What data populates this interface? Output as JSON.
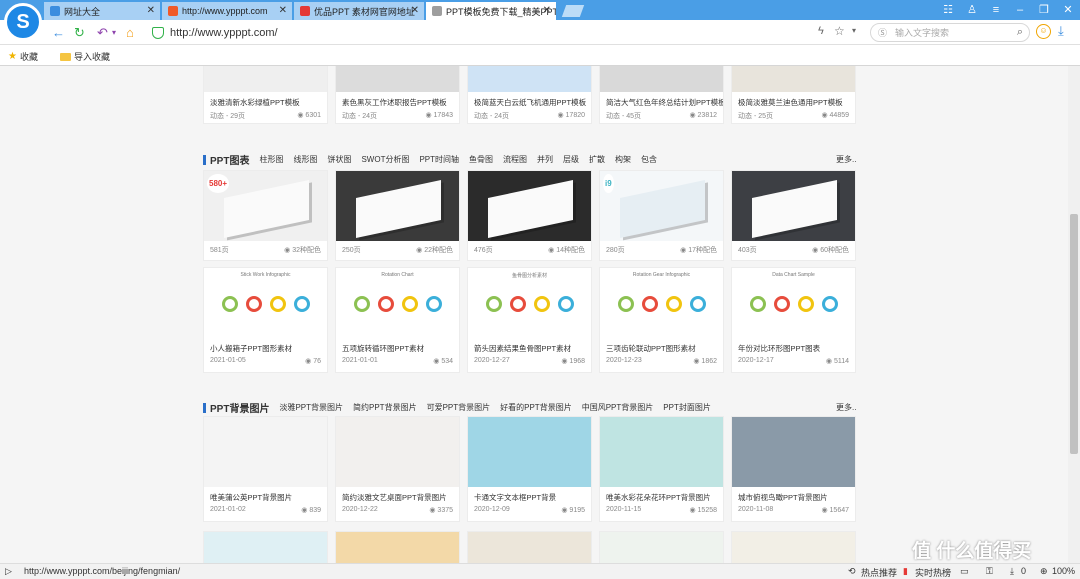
{
  "browser": {
    "tabs": [
      {
        "label": "网址大全",
        "fav_color": "#3b8ddf",
        "active": false
      },
      {
        "label": "http://www.ypppt.com",
        "fav_color": "#f05a28",
        "active": false
      },
      {
        "label": "优品PPT 素材网官网地址",
        "fav_color": "#e53935",
        "active": false
      },
      {
        "label": "PPT模板免费下载_精美PPT",
        "fav_color": "#9e9e9e",
        "active": true
      }
    ],
    "url": "http://www.ypppt.com/",
    "search_placeholder": "输入文字搜索",
    "bookmarks": [
      {
        "label": "收藏",
        "icon": "star-icon"
      },
      {
        "label": "导入收藏",
        "icon": "folder-icon"
      }
    ]
  },
  "sections": {
    "top_row": [
      {
        "title": "淡雅清新水彩绿植PPT模板",
        "left": "动态 - 29页",
        "count": "6301",
        "bg": "#efefef"
      },
      {
        "title": "素色黑灰工作述职报告PPT模板",
        "left": "动态 - 24页",
        "count": "17843",
        "bg": "#dcdcdc"
      },
      {
        "title": "极简蓝天白云纸飞机通用PPT模板",
        "left": "动态 - 24页",
        "count": "17820",
        "bg": "#cfe3f5"
      },
      {
        "title": "简洁大气红色年终总结计划PPT模板",
        "left": "动态 - 45页",
        "count": "23812",
        "bg": "#d9d9d9"
      },
      {
        "title": "极简淡雅莫兰迪色通用PPT模板",
        "left": "动态 - 25页",
        "count": "44859",
        "bg": "#e8e4dc"
      }
    ],
    "chart": {
      "heading": "PPT图表",
      "categories": [
        "柱形图",
        "线形图",
        "饼状图",
        "SWOT分析图",
        "PPT时间轴",
        "鱼骨图",
        "流程图",
        "并列",
        "层级",
        "扩散",
        "构架",
        "包含"
      ],
      "more": "更多..",
      "row1": [
        {
          "left": "581页",
          "count": "32种配色",
          "bg": "#f0f0f0",
          "badge": "580+"
        },
        {
          "left": "250页",
          "count": "22种配色",
          "bg": "#3a3a3a",
          "badge": ""
        },
        {
          "left": "476页",
          "count": "14种配色",
          "bg": "#2b2b2b",
          "badge": ""
        },
        {
          "left": "280页",
          "count": "17种配色",
          "bg": "#f4f7f9",
          "badge": "i9"
        },
        {
          "left": "403页",
          "count": "60种配色",
          "bg": "#3d3f44",
          "badge": ""
        }
      ],
      "row2": [
        {
          "title": "小人搬箱子PPT图形素材",
          "left": "2021-01-05",
          "count": "76",
          "caption": "Stick Work Infographic"
        },
        {
          "title": "五项旋转循环图PPT素材",
          "left": "2021-01-01",
          "count": "534",
          "caption": "Rotation Chart"
        },
        {
          "title": "箭头因素结果鱼骨图PPT素材",
          "left": "2020-12-27",
          "count": "1968",
          "caption": "鱼骨图分析素材"
        },
        {
          "title": "三项齿轮联动PPT图形素材",
          "left": "2020-12-23",
          "count": "1862",
          "caption": "Rotation Gear Infographic"
        },
        {
          "title": "年份对比环形图PPT图表",
          "left": "2020-12-17",
          "count": "5114",
          "caption": "Data Chart Sample"
        }
      ]
    },
    "bg": {
      "heading": "PPT背景图片",
      "categories": [
        "淡雅PPT背景图片",
        "简约PPT背景图片",
        "可爱PPT背景图片",
        "好看的PPT背景图片",
        "中国风PPT背景图片",
        "PPT封面图片"
      ],
      "more": "更多..",
      "row1": [
        {
          "title": "唯美蒲公英PPT背景图片",
          "left": "2021-01-02",
          "count": "839",
          "bg": "#f4f4f4"
        },
        {
          "title": "简约淡雅文艺桌面PPT背景图片",
          "left": "2020-12-22",
          "count": "3375",
          "bg": "#f2f0ee"
        },
        {
          "title": "卡通文字文本框PPT背景",
          "left": "2020-12-09",
          "count": "9195",
          "bg": "#9fd6e6"
        },
        {
          "title": "唯美水彩花朵花环PPT背景图片",
          "left": "2020-11-15",
          "count": "15258",
          "bg": "#bfe4e2"
        },
        {
          "title": "城市俯视鸟瞰PPT背景图片",
          "left": "2020-11-08",
          "count": "15647",
          "bg": "#8a9aa8"
        }
      ],
      "row2_colors": [
        "#dff0f4",
        "#f3d9a8",
        "#ece6da",
        "#eef3ee",
        "#f2efe6"
      ]
    }
  },
  "status": {
    "url": "http://www.ypppt.com/beijing/fengmian/",
    "hot": "热点推荐",
    "realtime": "实时热榜",
    "count": "0",
    "zoom": "100%",
    "watermark": "值 什么值得买"
  }
}
